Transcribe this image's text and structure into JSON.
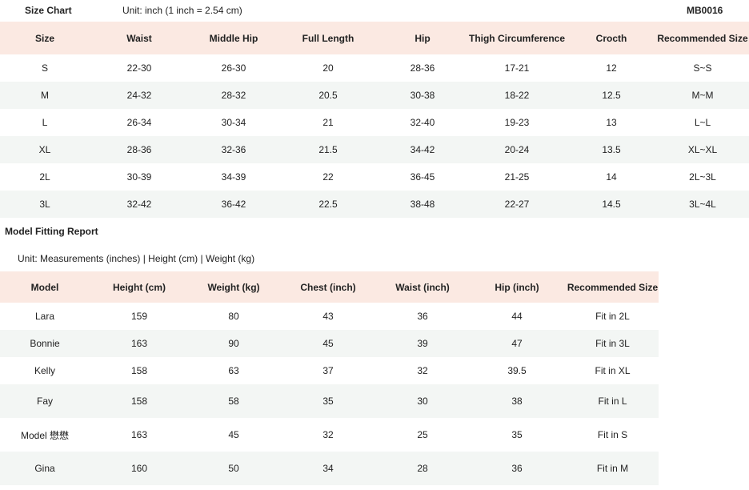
{
  "size_chart": {
    "title": "Size Chart",
    "unit": "Unit: inch (1 inch = 2.54 cm)",
    "code": "MB0016",
    "columns": [
      "Size",
      "Waist",
      "Middle Hip",
      "Full Length",
      "Hip",
      "Thigh Circumference",
      "Crocth",
      "Recommended Size"
    ],
    "rows": [
      [
        "S",
        "22-30",
        "26-30",
        "20",
        "28-36",
        "17-21",
        "12",
        "S~S"
      ],
      [
        "M",
        "24-32",
        "28-32",
        "20.5",
        "30-38",
        "18-22",
        "12.5",
        "M~M"
      ],
      [
        "L",
        "26-34",
        "30-34",
        "21",
        "32-40",
        "19-23",
        "13",
        "L~L"
      ],
      [
        "XL",
        "28-36",
        "32-36",
        "21.5",
        "34-42",
        "20-24",
        "13.5",
        "XL~XL"
      ],
      [
        "2L",
        "30-39",
        "34-39",
        "22",
        "36-45",
        "21-25",
        "14",
        "2L~3L"
      ],
      [
        "3L",
        "32-42",
        "36-42",
        "22.5",
        "38-48",
        "22-27",
        "14.5",
        "3L~4L"
      ]
    ]
  },
  "model_fitting": {
    "title": "Model Fitting Report",
    "unit": "Unit: Measurements (inches) | Height (cm) | Weight (kg)",
    "columns": [
      "Model",
      "Height (cm)",
      "Weight (kg)",
      "Chest (inch)",
      "Waist (inch)",
      "Hip (inch)",
      "Recommended Size"
    ],
    "rows": [
      [
        "Lara",
        "159",
        "80",
        "43",
        "36",
        "44",
        "Fit in 2L"
      ],
      [
        "Bonnie",
        "163",
        "90",
        "45",
        "39",
        "47",
        "Fit in 3L"
      ],
      [
        "Kelly",
        "158",
        "63",
        "37",
        "32",
        "39.5",
        "Fit in XL"
      ],
      [
        "Fay",
        "158",
        "58",
        "35",
        "30",
        "38",
        "Fit in L"
      ],
      [
        "Model 懋懋",
        "163",
        "45",
        "32",
        "25",
        "35",
        "Fit in S"
      ],
      [
        "Gina",
        "160",
        "50",
        "34",
        "28",
        "36",
        "Fit in M"
      ]
    ]
  },
  "colors": {
    "header_bg": "#fbe9e2",
    "stripe_bg": "#f3f6f4"
  }
}
